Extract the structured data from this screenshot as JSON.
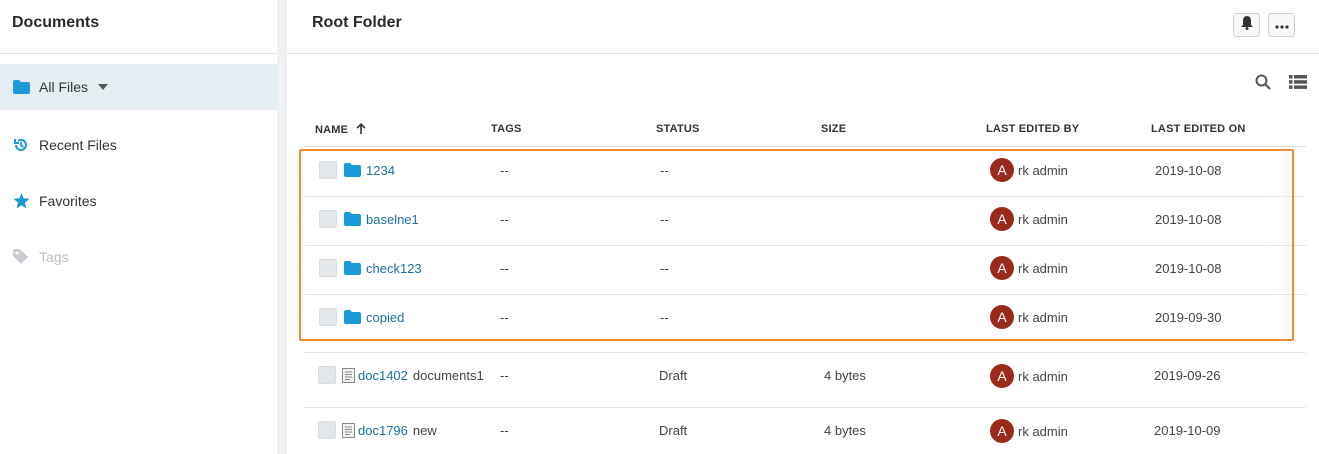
{
  "sidebar": {
    "title": "Documents",
    "items": [
      {
        "label": "All Files",
        "icon": "folder-icon"
      },
      {
        "label": "Recent Files",
        "icon": "history-icon"
      },
      {
        "label": "Favorites",
        "icon": "star-icon"
      },
      {
        "label": "Tags",
        "icon": "tag-icon"
      }
    ]
  },
  "header": {
    "title": "Root Folder"
  },
  "table": {
    "columns": [
      "NAME",
      "TAGS",
      "STATUS",
      "SIZE",
      "LAST EDITED BY",
      "LAST EDITED ON"
    ],
    "rows": [
      {
        "type": "folder",
        "name": "1234",
        "suffix": "",
        "tags": "--",
        "status": "--",
        "size": "",
        "avatar": "A",
        "editor": "rk admin",
        "date": "2019-10-08"
      },
      {
        "type": "folder",
        "name": "baselne1",
        "suffix": "",
        "tags": "--",
        "status": "--",
        "size": "",
        "avatar": "A",
        "editor": "rk admin",
        "date": "2019-10-08"
      },
      {
        "type": "folder",
        "name": "check123",
        "suffix": "",
        "tags": "--",
        "status": "--",
        "size": "",
        "avatar": "A",
        "editor": "rk admin",
        "date": "2019-10-08"
      },
      {
        "type": "folder",
        "name": "copied",
        "suffix": "",
        "tags": "--",
        "status": "--",
        "size": "",
        "avatar": "A",
        "editor": "rk admin",
        "date": "2019-09-30"
      },
      {
        "type": "document",
        "name": "doc1402",
        "suffix": "documents1",
        "tags": "--",
        "status": "Draft",
        "size": "4 bytes",
        "avatar": "A",
        "editor": "rk admin",
        "date": "2019-09-26"
      },
      {
        "type": "document",
        "name": "doc1796",
        "suffix": "new",
        "tags": "--",
        "status": "Draft",
        "size": "4 bytes",
        "avatar": "A",
        "editor": "rk admin",
        "date": "2019-10-09"
      }
    ]
  },
  "colors": {
    "accent": "#1a9bd7",
    "link": "#1a6fa0",
    "avatar": "#9a2a1b",
    "highlight": "#f28a2e",
    "active_nav": "#e4eef2"
  }
}
